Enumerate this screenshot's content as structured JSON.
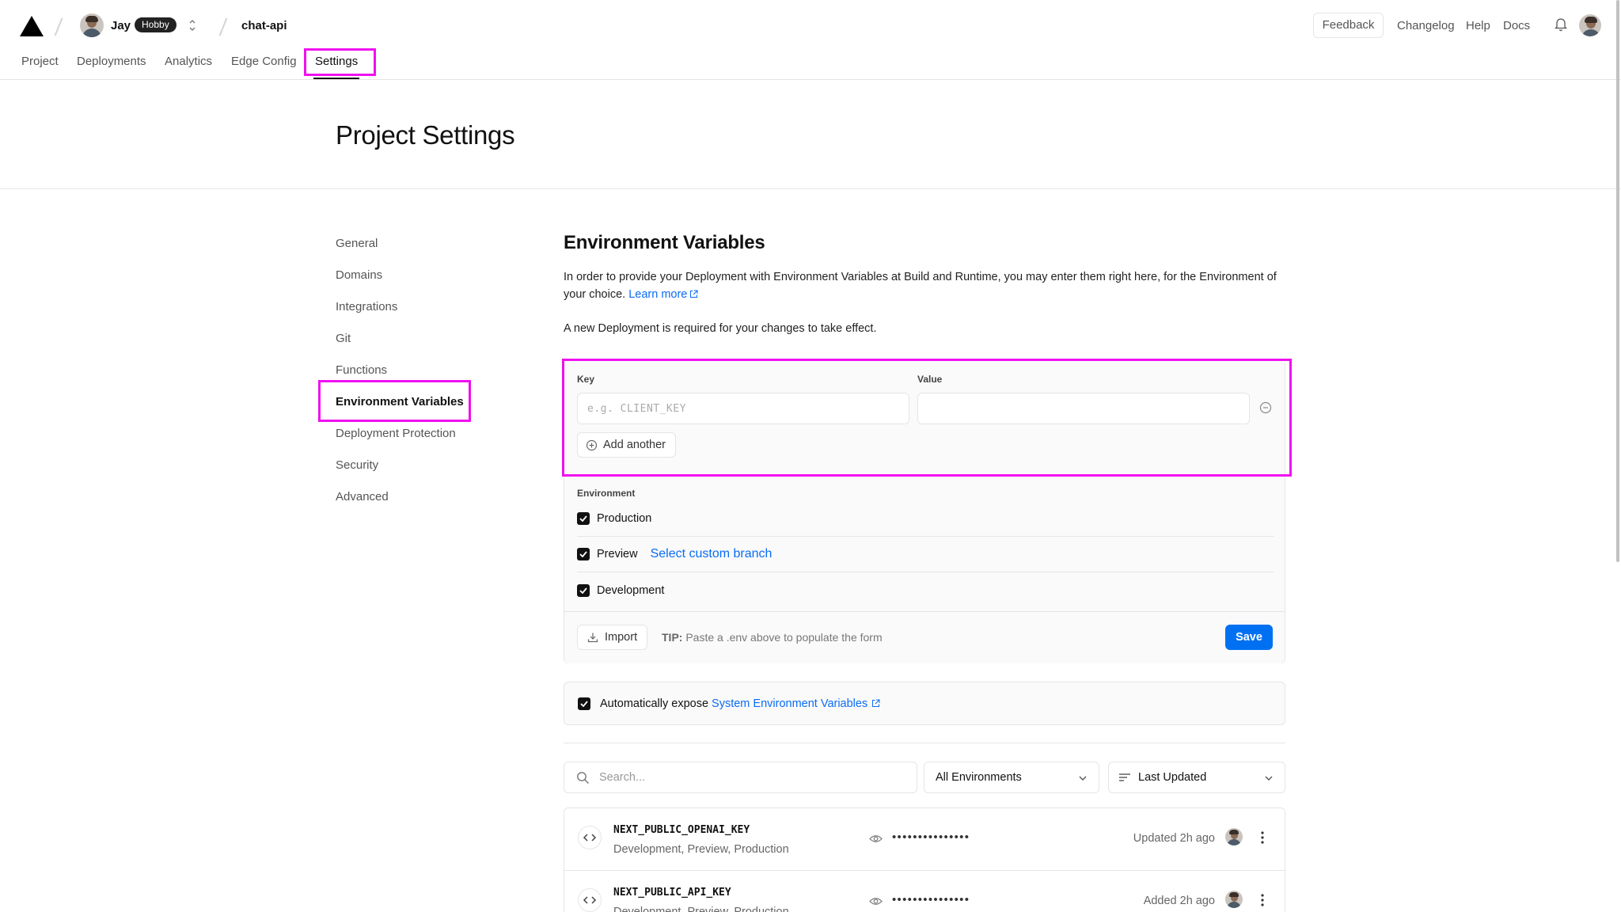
{
  "header": {
    "logo_icon": "vercel-triangle-icon",
    "user": {
      "name": "Jay",
      "plan": "Hobby"
    },
    "project": "chat-api",
    "feedback": "Feedback",
    "links": [
      "Changelog",
      "Help",
      "Docs"
    ]
  },
  "nav": {
    "tabs": [
      "Project",
      "Deployments",
      "Analytics",
      "Edge Config",
      "Settings"
    ],
    "active": "Settings"
  },
  "page": {
    "title": "Project Settings"
  },
  "sidebar": {
    "items": [
      "General",
      "Domains",
      "Integrations",
      "Git",
      "Functions",
      "Environment Variables",
      "Deployment Protection",
      "Security",
      "Advanced"
    ],
    "active": "Environment Variables"
  },
  "env_vars": {
    "title": "Environment Variables",
    "description": "In order to provide your Deployment with Environment Variables at Build and Runtime, you may enter them right here, for the Environment of your choice.",
    "learn_more": "Learn more",
    "notice": "A new Deployment is required for your changes to take effect.",
    "form": {
      "key_label": "Key",
      "key_placeholder": "e.g. CLIENT_KEY",
      "key_value": "",
      "value_label": "Value",
      "value_value": "",
      "add_another": "Add another",
      "environment_label": "Environment",
      "environments": [
        {
          "name": "Production",
          "checked": true
        },
        {
          "name": "Preview",
          "checked": true,
          "link": "Select custom branch"
        },
        {
          "name": "Development",
          "checked": true
        }
      ],
      "import": "Import",
      "tip_label": "TIP:",
      "tip_text": "Paste a .env above to populate the form",
      "save": "Save"
    },
    "auto_expose": {
      "checked": true,
      "text": "Automatically expose",
      "link": "System Environment Variables"
    },
    "filters": {
      "search_placeholder": "Search...",
      "environment_select": "All Environments",
      "sort_select": "Last Updated"
    },
    "variables": [
      {
        "name": "NEXT_PUBLIC_OPENAI_KEY",
        "environments": "Development, Preview, Production",
        "masked": "•••••••••••••••",
        "status": "Updated 2h ago"
      },
      {
        "name": "NEXT_PUBLIC_API_KEY",
        "environments": "Development, Preview, Production",
        "masked": "•••••••••••••••",
        "status": "Added 2h ago"
      }
    ]
  },
  "colors": {
    "accent": "#0070f3",
    "link": "#0a6cf5",
    "highlight": "#f010f0",
    "border": "#e5e5e5"
  }
}
